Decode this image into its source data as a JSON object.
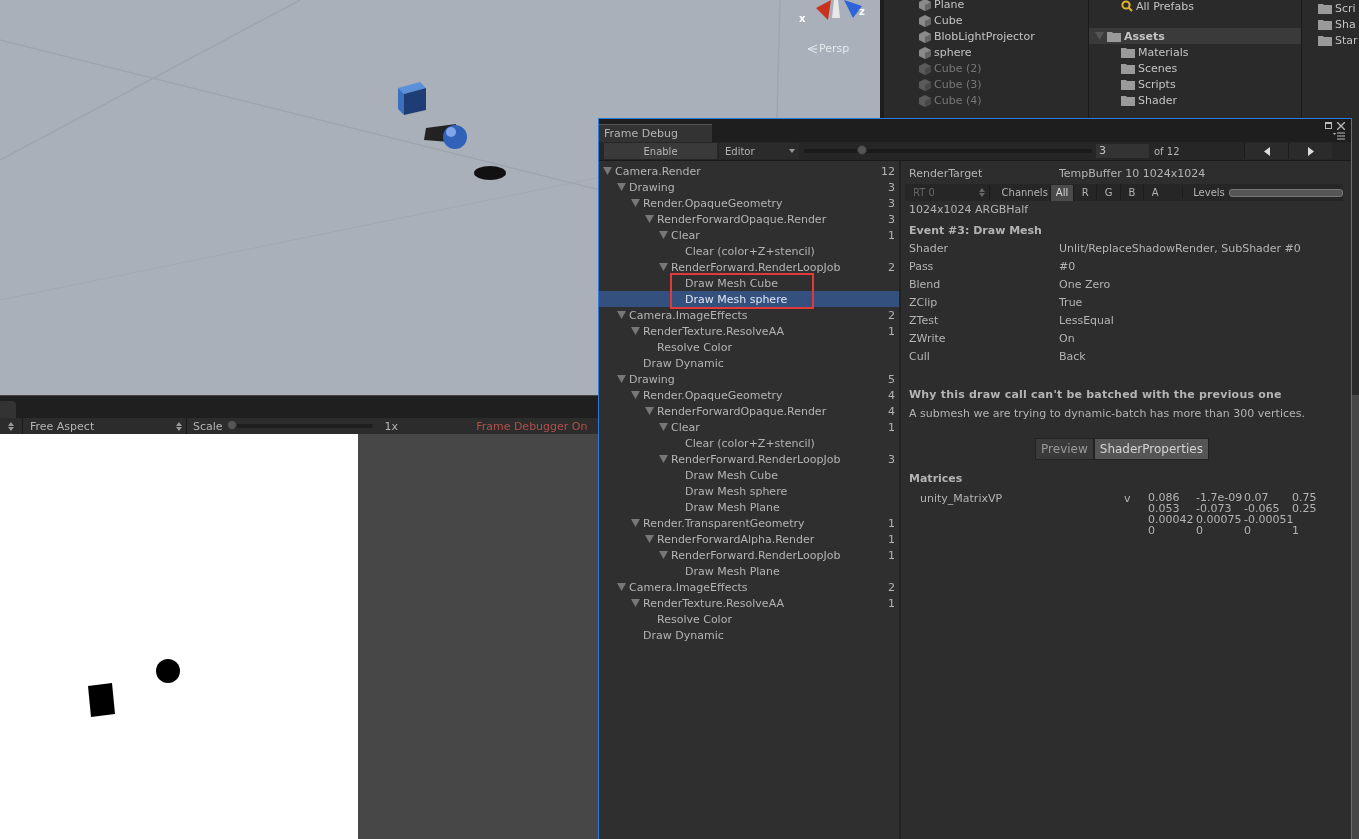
{
  "scene_view": {
    "axis_labels": [
      "x",
      "z"
    ],
    "projection": "Persp"
  },
  "hierarchy": {
    "items": [
      {
        "label": "Plane",
        "active": true
      },
      {
        "label": "Cube",
        "active": true
      },
      {
        "label": "BlobLightProjector",
        "active": true
      },
      {
        "label": "sphere",
        "active": true
      },
      {
        "label": "Cube (2)",
        "active": false
      },
      {
        "label": "Cube (3)",
        "active": false
      },
      {
        "label": "Cube (4)",
        "active": false
      }
    ]
  },
  "project": {
    "favorites": [
      {
        "label": "All Prefabs"
      }
    ],
    "tree": [
      {
        "label": "Assets",
        "selected": true,
        "expanded": true,
        "children": [
          {
            "label": "Materials",
            "selected": false
          },
          {
            "label": "Scenes",
            "selected": false
          },
          {
            "label": "Scripts",
            "selected": false
          },
          {
            "label": "Shader",
            "selected": false
          }
        ]
      }
    ],
    "files": [
      "Scri",
      "Sha",
      "Star"
    ]
  },
  "game_view": {
    "aspect": "Free Aspect",
    "scale_label": "Scale",
    "scale": {
      "level": 0
    },
    "scale_reading": "1x",
    "status": "Frame Debugger On"
  },
  "frame_debug": {
    "title": "Frame Debug",
    "enable_button": "Enable",
    "target": "Editor",
    "event_slider": {
      "level": 0.19
    },
    "event_index": "3",
    "event_total": "of 12",
    "tree": [
      {
        "label": "Camera.Render",
        "count": "12",
        "expanded": true,
        "selected": false,
        "annotated": false,
        "children": [
          {
            "label": "Drawing",
            "count": "3",
            "expanded": true,
            "selected": false,
            "annotated": false,
            "children": [
              {
                "label": "Render.OpaqueGeometry",
                "count": "3",
                "expanded": true,
                "selected": false,
                "annotated": false,
                "children": [
                  {
                    "label": "RenderForwardOpaque.Render",
                    "count": "3",
                    "expanded": true,
                    "selected": false,
                    "annotated": false,
                    "children": [
                      {
                        "label": "Clear",
                        "count": "1",
                        "expanded": true,
                        "selected": false,
                        "annotated": false,
                        "children": [
                          {
                            "label": "Clear (color+Z+stencil)",
                            "selected": false,
                            "annotated": false
                          }
                        ]
                      },
                      {
                        "label": "RenderForward.RenderLoopJob",
                        "count": "2",
                        "expanded": true,
                        "selected": false,
                        "annotated": false,
                        "children": [
                          {
                            "label": "Draw Mesh Cube",
                            "selected": false,
                            "annotated": true
                          },
                          {
                            "label": "Draw Mesh sphere",
                            "selected": true,
                            "annotated": true
                          }
                        ]
                      }
                    ]
                  }
                ]
              }
            ]
          },
          {
            "label": "Camera.ImageEffects",
            "count": "2",
            "expanded": true,
            "selected": false,
            "annotated": false,
            "children": [
              {
                "label": "RenderTexture.ResolveAA",
                "count": "1",
                "expanded": true,
                "selected": false,
                "annotated": false,
                "children": [
                  {
                    "label": "Resolve Color",
                    "selected": false,
                    "annotated": false
                  }
                ]
              },
              {
                "label": "Draw Dynamic",
                "selected": false,
                "annotated": false
              }
            ]
          },
          {
            "label": "Drawing",
            "count": "5",
            "expanded": true,
            "selected": false,
            "annotated": false,
            "children": [
              {
                "label": "Render.OpaqueGeometry",
                "count": "4",
                "expanded": true,
                "selected": false,
                "annotated": false,
                "children": [
                  {
                    "label": "RenderForwardOpaque.Render",
                    "count": "4",
                    "expanded": true,
                    "selected": false,
                    "annotated": false,
                    "children": [
                      {
                        "label": "Clear",
                        "count": "1",
                        "expanded": true,
                        "selected": false,
                        "annotated": false,
                        "children": [
                          {
                            "label": "Clear (color+Z+stencil)",
                            "selected": false,
                            "annotated": false
                          }
                        ]
                      },
                      {
                        "label": "RenderForward.RenderLoopJob",
                        "count": "3",
                        "expanded": true,
                        "selected": false,
                        "annotated": false,
                        "children": [
                          {
                            "label": "Draw Mesh Cube",
                            "selected": false,
                            "annotated": false
                          },
                          {
                            "label": "Draw Mesh sphere",
                            "selected": false,
                            "annotated": false
                          },
                          {
                            "label": "Draw Mesh Plane",
                            "selected": false,
                            "annotated": false
                          }
                        ]
                      }
                    ]
                  }
                ]
              },
              {
                "label": "Render.TransparentGeometry",
                "count": "1",
                "expanded": true,
                "selected": false,
                "annotated": false,
                "children": [
                  {
                    "label": "RenderForwardAlpha.Render",
                    "count": "1",
                    "expanded": true,
                    "selected": false,
                    "annotated": false,
                    "children": [
                      {
                        "label": "RenderForward.RenderLoopJob",
                        "count": "1",
                        "expanded": true,
                        "selected": false,
                        "annotated": false,
                        "children": [
                          {
                            "label": "Draw Mesh Plane",
                            "selected": false,
                            "annotated": false
                          }
                        ]
                      }
                    ]
                  }
                ]
              }
            ]
          },
          {
            "label": "Camera.ImageEffects",
            "count": "2",
            "expanded": true,
            "selected": false,
            "annotated": false,
            "children": [
              {
                "label": "RenderTexture.ResolveAA",
                "count": "1",
                "expanded": true,
                "selected": false,
                "annotated": false,
                "children": [
                  {
                    "label": "Resolve Color",
                    "selected": false,
                    "annotated": false
                  }
                ]
              },
              {
                "label": "Draw Dynamic",
                "selected": false,
                "annotated": false
              }
            ]
          }
        ]
      }
    ],
    "detail": {
      "render_target_label": "RenderTarget",
      "render_target": "TempBuffer 10 1024x1024",
      "rt_select": "RT 0",
      "channels_label": "Channels",
      "channels": [
        {
          "label": "All",
          "selected": true
        },
        {
          "label": "R",
          "selected": false
        },
        {
          "label": "G",
          "selected": false
        },
        {
          "label": "B",
          "selected": false
        },
        {
          "label": "A",
          "selected": false
        }
      ],
      "levels_label": "Levels",
      "format": "1024x1024 ARGBHalf",
      "event_title": "Event #3: Draw Mesh",
      "properties": [
        {
          "name": "Shader",
          "value": "Unlit/ReplaceShadowRender, SubShader #0"
        },
        {
          "name": "Pass",
          "value": "#0"
        },
        {
          "name": "Blend",
          "value": "One Zero"
        },
        {
          "name": "ZClip",
          "value": "True"
        },
        {
          "name": "ZTest",
          "value": "LessEqual"
        },
        {
          "name": "ZWrite",
          "value": "On"
        },
        {
          "name": "Cull",
          "value": "Back"
        }
      ],
      "batch_heading": "Why this draw call can't be batched with the previous one",
      "batch_reason": "A submesh we are trying to dynamic-batch has more than 300 vertices.",
      "tabs": [
        {
          "label": "Preview",
          "selected": false
        },
        {
          "label": "ShaderProperties",
          "selected": true
        }
      ],
      "matrices_heading": "Matrices",
      "matrices": [
        {
          "name": "unity_MatrixVP",
          "type": "v",
          "values": [
            [
              "0.086",
              "-1.7e-09",
              "0.07",
              "0.75"
            ],
            [
              "0.053",
              "-0.073",
              "-0.065",
              "0.25"
            ],
            [
              "0.00042",
              "0.00075",
              "-0.00051"
            ],
            [
              "0",
              "0",
              "0",
              "1"
            ]
          ]
        }
      ]
    }
  }
}
